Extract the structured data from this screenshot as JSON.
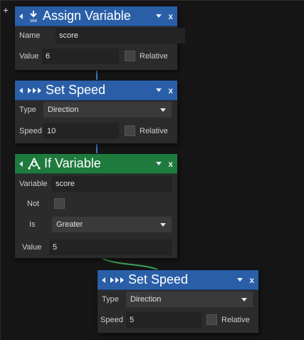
{
  "nodes": {
    "assign_variable": {
      "title": "Assign Variable",
      "icon": "var-download-icon",
      "name_label": "Name",
      "name_value": "score",
      "value_label": "Value",
      "value_value": "6",
      "relative_label": "Relative"
    },
    "set_speed_1": {
      "title": "Set Speed",
      "icon": "speed-arrows-icon",
      "type_label": "Type",
      "type_value": "Direction",
      "speed_label": "Speed",
      "speed_value": "10",
      "relative_label": "Relative"
    },
    "if_variable": {
      "title": "If Variable",
      "icon": "branch-icon",
      "variable_label": "Variable",
      "variable_value": "score",
      "not_label": "Not",
      "is_label": "Is",
      "is_value": "Greater",
      "value_label": "Value",
      "value_value": "5"
    },
    "set_speed_2": {
      "title": "Set Speed",
      "icon": "speed-arrows-icon",
      "type_label": "Type",
      "type_value": "Direction",
      "speed_label": "Speed",
      "speed_value": "5",
      "relative_label": "Relative"
    }
  },
  "header_controls": {
    "close": "x"
  },
  "canvas": {
    "add_symbol": "+"
  },
  "colors": {
    "action_header": "#2a5fa8",
    "condition_header": "#1f7a3e",
    "node_body": "#2b2b2b",
    "background": "#161616"
  }
}
